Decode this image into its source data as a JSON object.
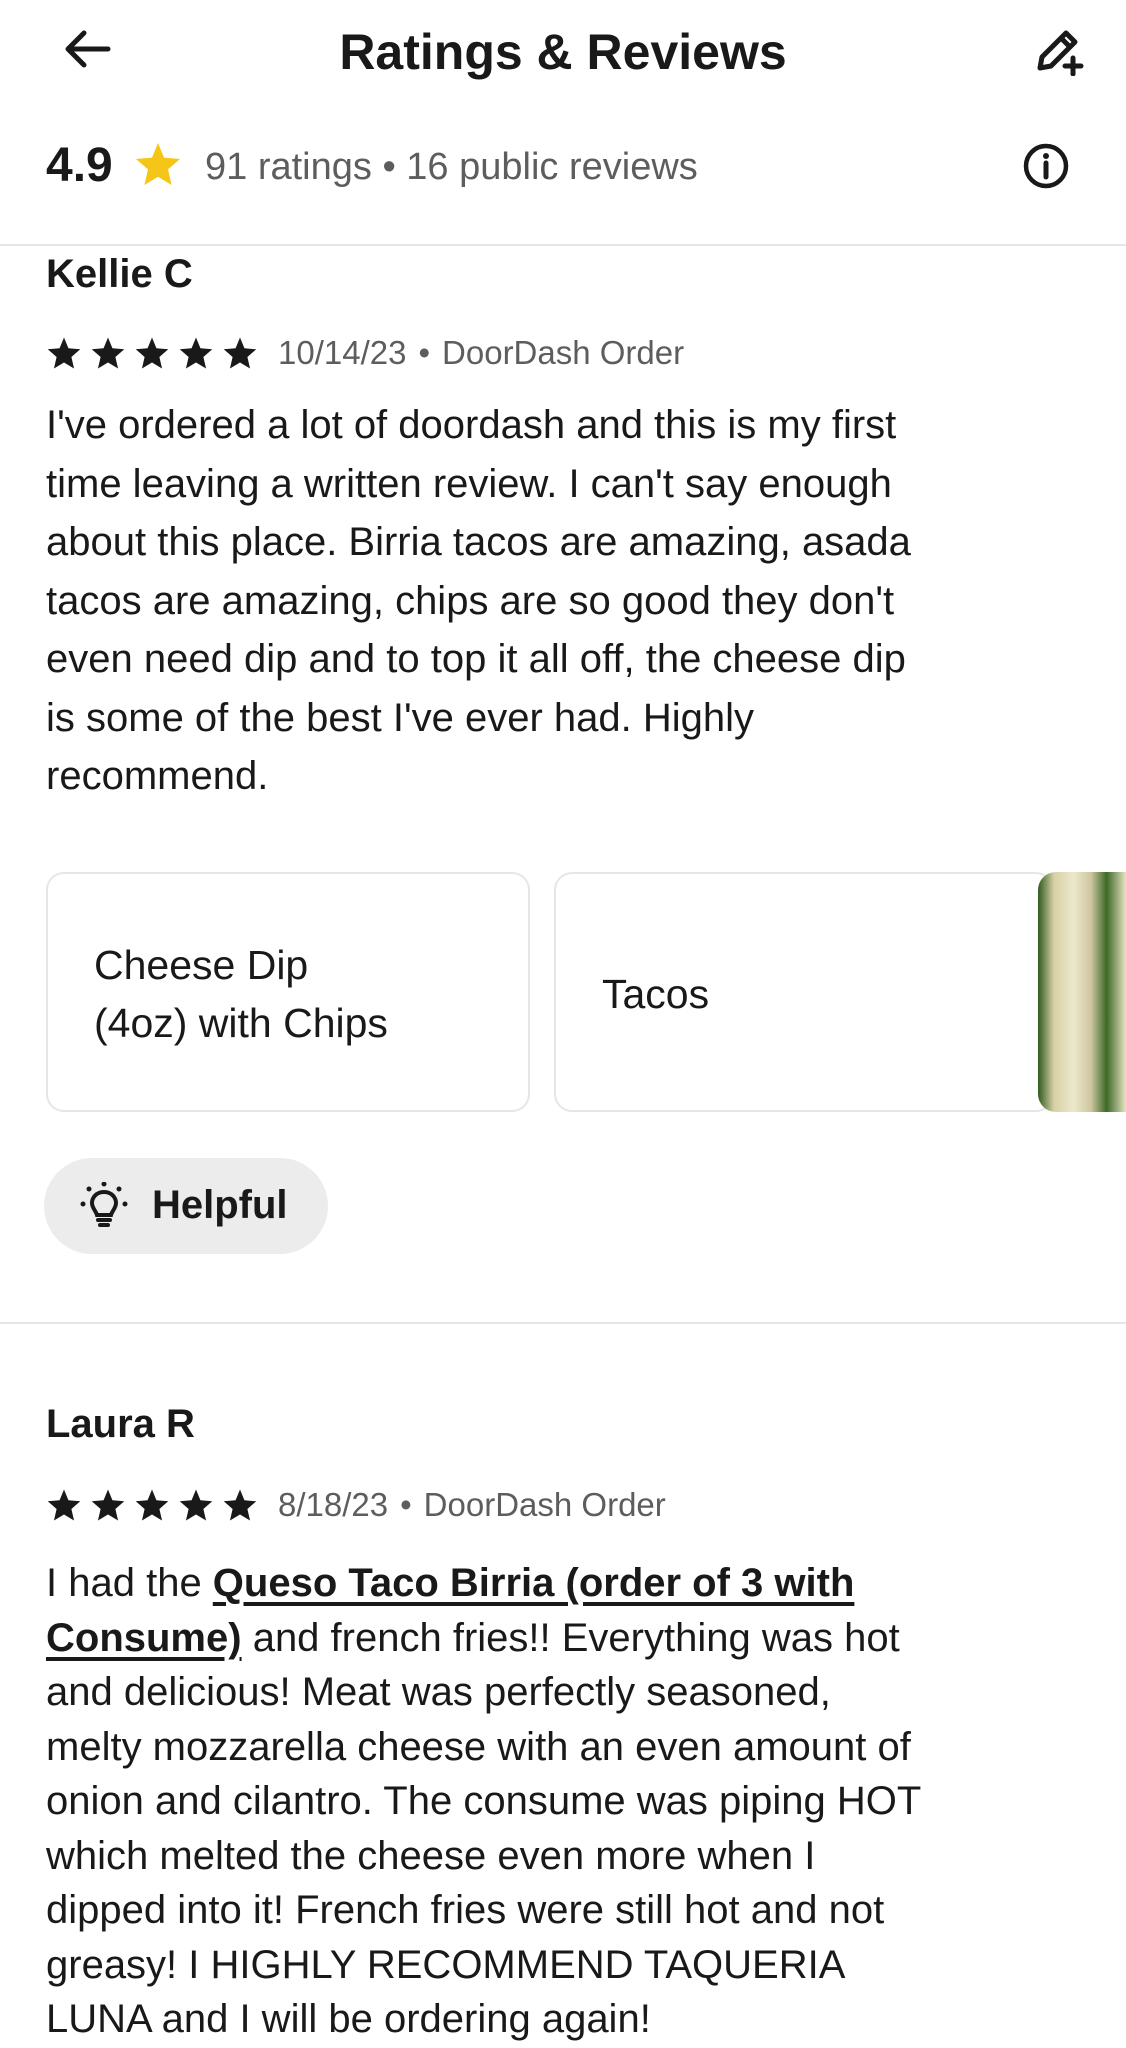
{
  "header": {
    "title": "Ratings & Reviews",
    "back_icon": "arrow-left-icon",
    "edit_icon": "pencil-plus-icon"
  },
  "summary": {
    "average": "4.9",
    "star_color": "#f5c518",
    "text": "91 ratings • 16 public reviews",
    "info_icon": "info-icon"
  },
  "reviews": [
    {
      "name": "Kellie C",
      "rating": 5,
      "date": "10/14/23",
      "source": "DoorDash Order",
      "lines": [
        "I've ordered a lot of doordash and this is my first",
        "time leaving a written review. I can't say enough",
        "about this place. Birria tacos are amazing, asada",
        "tacos are amazing, chips are so good they don't",
        "even need dip and to top it all off, the cheese dip",
        "is some of the best I've ever had. Highly",
        "recommend."
      ],
      "items": [
        {
          "line1": "Cheese Dip",
          "line2": "(4oz) with Chips"
        },
        {
          "line1": "Tacos"
        }
      ],
      "helpful_label": "Helpful"
    },
    {
      "name": "Laura R",
      "rating": 5,
      "date": "8/18/23",
      "source": "DoorDash Order",
      "text_prefix": "I had the ",
      "item_link_part1": "Queso Taco Birria (order of 3 with",
      "item_link_part2": "Consume)",
      "line2_rest": " and french fries!! Everything was hot",
      "lines_rest": [
        "and delicious! Meat was perfectly seasoned,",
        "melty mozzarella cheese with an even amount of",
        "onion and cilantro. The consume was piping HOT",
        "which melted the cheese even more when I",
        "dipped into it! French fries were still hot and not",
        "greasy! I HIGHLY RECOMMEND TAQUERIA",
        "LUNA and I will be ordering again!"
      ]
    }
  ]
}
